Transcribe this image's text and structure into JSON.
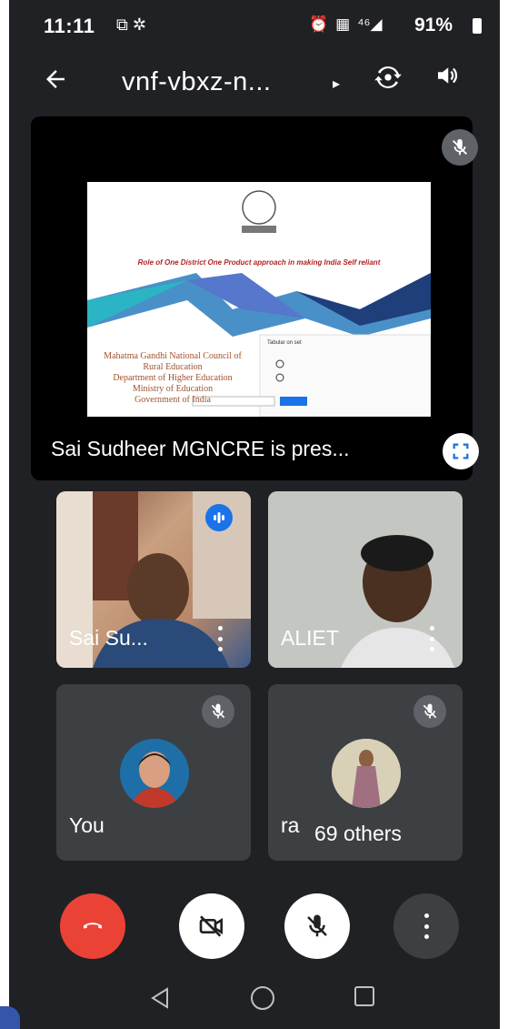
{
  "status_bar": {
    "time": "11:11",
    "left_icons": "⧉ ✲",
    "right_icons": [
      "⏰",
      "▦",
      "⁴⁶◢"
    ],
    "battery": "91%"
  },
  "top_bar": {
    "back_icon": "arrow-left",
    "meeting_code": "vnf-vbxz-n...",
    "expand_icon": "▸",
    "switch_camera_icon": "switch-camera",
    "speaker_icon": "speaker"
  },
  "presentation": {
    "caption": "Sai Sudheer MGNCRE is pres...",
    "slide": {
      "title": "Role of One District One Product approach in making India Self reliant",
      "org_lines": [
        "Mahatma Gandhi National Council of",
        "Rural Education",
        "Department of Higher Education",
        "Ministry of Education",
        "Government of India"
      ],
      "poll_label": "Tabular on set"
    }
  },
  "participants": [
    {
      "name": "Sai Su...",
      "speaking": true,
      "muted": false,
      "type": "video"
    },
    {
      "name": "ALIET",
      "speaking": false,
      "muted": false,
      "type": "video"
    },
    {
      "name": "You",
      "speaking": false,
      "muted": true,
      "type": "avatar"
    },
    {
      "name": "ra",
      "speaking": false,
      "muted": true,
      "type": "avatar"
    }
  ],
  "others_label": "69 others",
  "controls": [
    {
      "name": "end-call",
      "color": "#ea4335"
    },
    {
      "name": "camera-off",
      "color": "#ffffff"
    },
    {
      "name": "mic-off",
      "color": "#ffffff"
    },
    {
      "name": "more-options",
      "color": "#3c4043"
    }
  ],
  "colors": {
    "background": "#202124",
    "tile": "#3c4043",
    "end_call": "#ea4335",
    "speaking_indicator": "#1a73e8"
  }
}
